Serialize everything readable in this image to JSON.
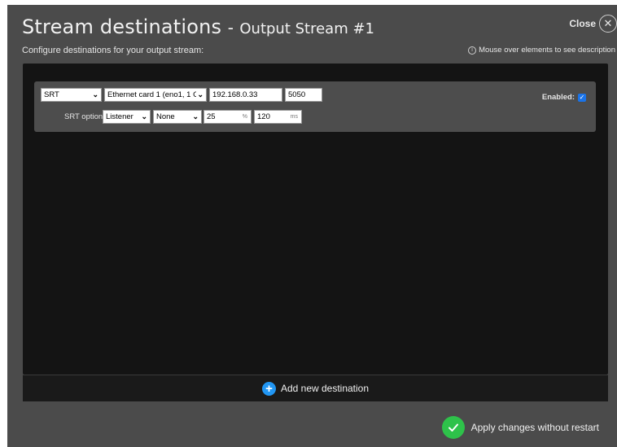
{
  "header": {
    "title_main": "Stream destinations",
    "title_dash": "-",
    "title_sub": "Output Stream #1",
    "close_label": "Close",
    "close_icon": "close-icon",
    "subtitle": "Configure destinations for your output stream:",
    "hint": "Mouse over elements to see description",
    "hint_icon_glyph": "i"
  },
  "destination": {
    "protocol": "SRT",
    "interface": "Ethernet card 1 (eno1, 1 G",
    "ip": "192.168.0.33",
    "port": "5050",
    "enabled_label": "Enabled:",
    "enabled": true,
    "srt_options_label": "SRT options:",
    "srt_mode": "Listener",
    "srt_encryption": "None",
    "overhead_value": "25",
    "overhead_unit": "%",
    "latency_value": "120",
    "latency_unit": "ms"
  },
  "footer": {
    "add_label": "Add new destination",
    "apply_label": "Apply changes without restart"
  },
  "colors": {
    "dialog_bg": "#4b4b4b",
    "panel_bg": "#141414",
    "accent_blue": "#2196f3",
    "accent_green": "#2ec24a"
  }
}
